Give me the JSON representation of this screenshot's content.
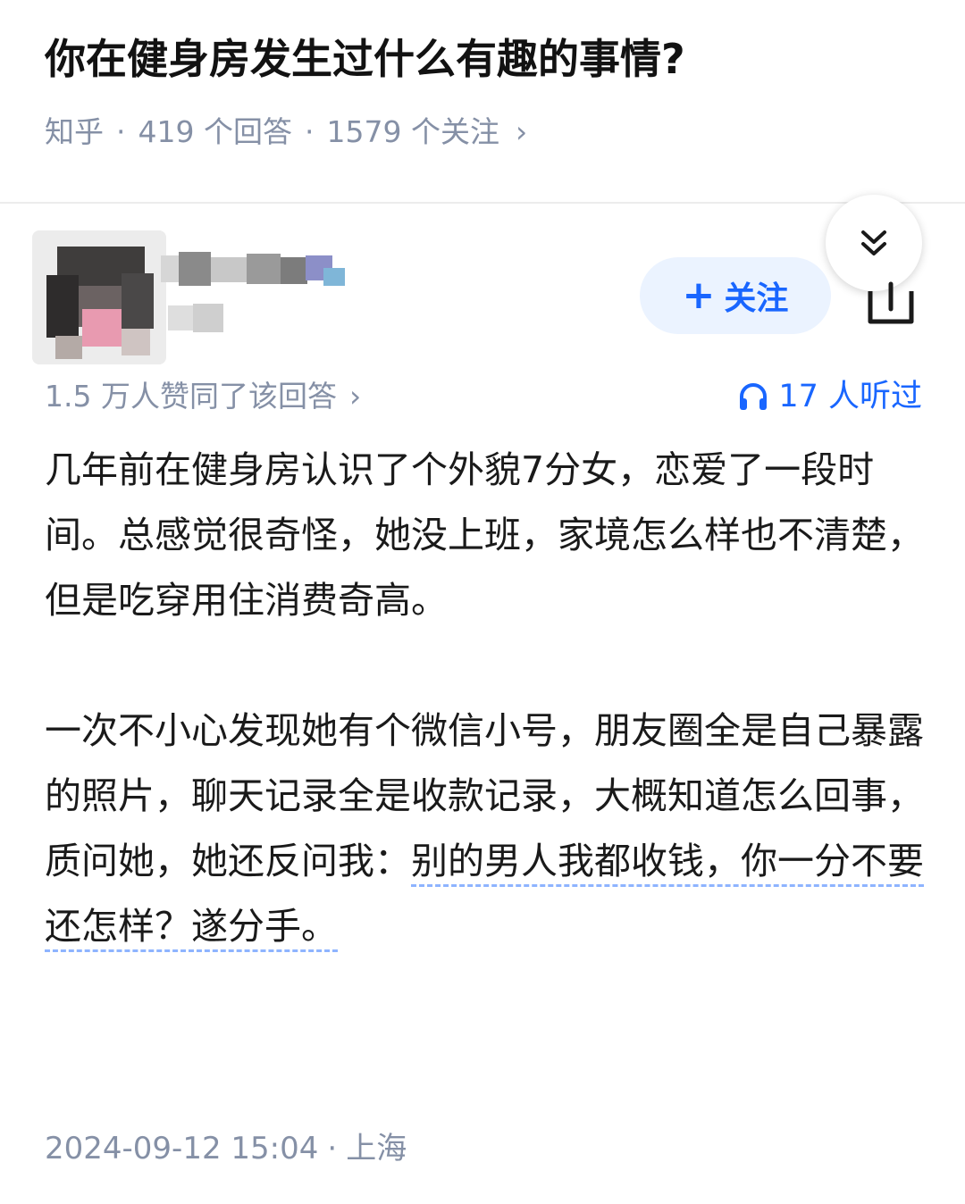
{
  "question": {
    "title": "你在健身房发生过什么有趣的事情?",
    "source": "知乎",
    "answers": "419 个回答",
    "followers": "1579 个关注",
    "separator": "·",
    "chevron": "›"
  },
  "author": {
    "follow_label": "关注",
    "follow_icon": "plus-icon"
  },
  "stats": {
    "likes": "1.5 万人赞同了该回答",
    "chevron": "›",
    "listened": "17 人听过",
    "listened_icon": "headphones-icon"
  },
  "answer": {
    "paragraph_1": "几年前在健身房认识了个外貌7分女，恋爱了一段时间。总感觉很奇怪，她没上班，家境怎么样也不清楚，但是吃穿用住消费奇高。",
    "paragraph_2_plain": "一次不小心发现她有个微信小号，朋友圈全是自己暴露的照片，聊天记录全是收款记录，大概知道怎么回事，质问她，她还反问我：",
    "paragraph_2_highlight": "别的男人我都收钱，你一分不要还怎样？遂分手。"
  },
  "footer": {
    "date": "2024-09-12 15:04",
    "separator": "·",
    "location": "上海"
  },
  "colors": {
    "accent": "#1966ff",
    "meta_gray": "#8590a6",
    "follow_bg": "#ebf3ff",
    "highlight_underline": "#8eb4ff"
  }
}
